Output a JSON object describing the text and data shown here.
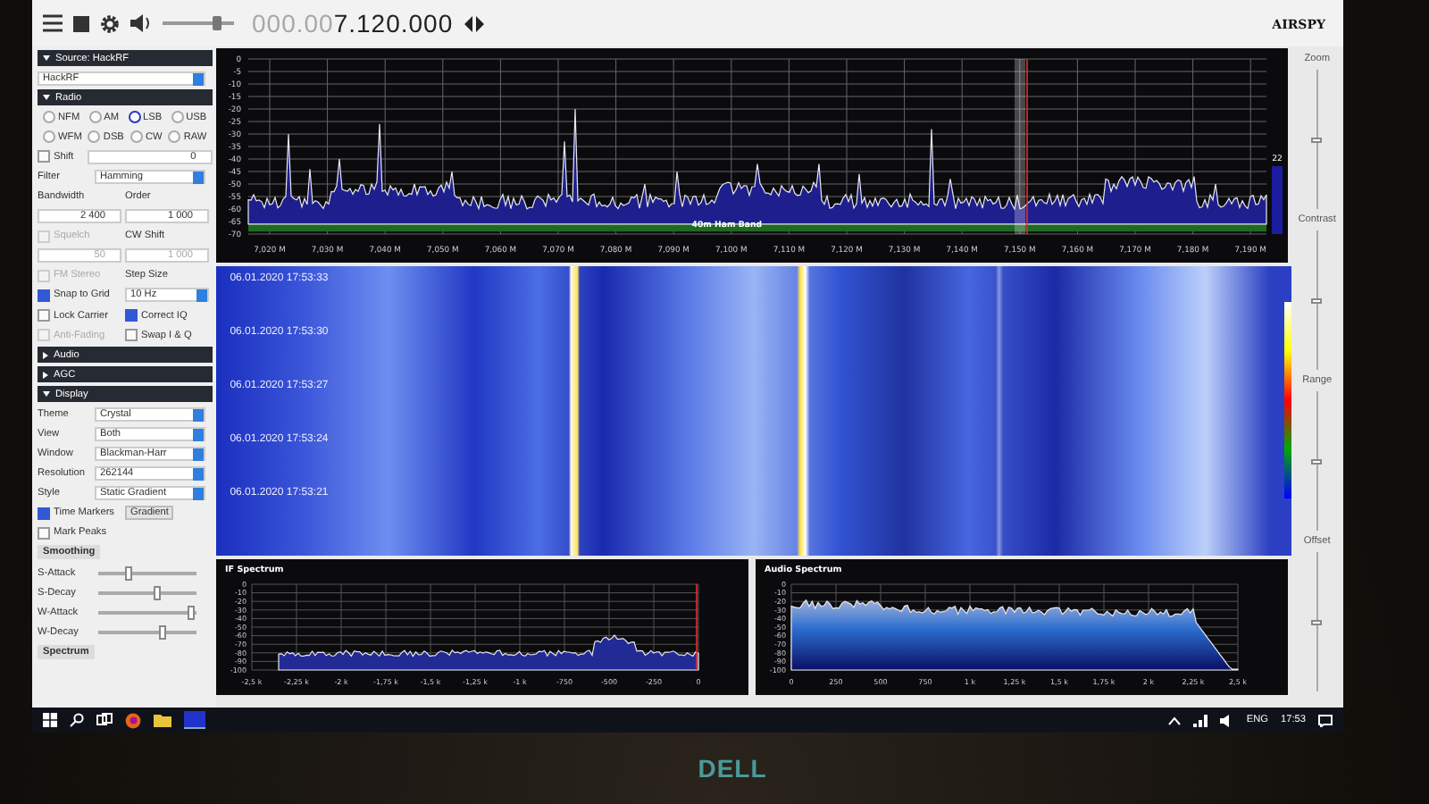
{
  "toolbar": {
    "volume": {
      "level": 0.75
    },
    "frequency_dim": "000.00",
    "frequency": "7.120.000",
    "logo": "AIRSPY"
  },
  "sidebar": {
    "rows": [
      {
        "kind": "header",
        "label": "Source: HackRF",
        "expanded": true
      },
      {
        "kind": "select",
        "value": "HackRF"
      },
      {
        "kind": "header",
        "label": "Radio",
        "expanded": true
      },
      {
        "kind": "radios",
        "options": [
          {
            "label": "NFM",
            "selected": false
          },
          {
            "label": "AM",
            "selected": false
          },
          {
            "label": "LSB",
            "selected": true
          },
          {
            "label": "USB",
            "selected": false
          }
        ]
      },
      {
        "kind": "radios",
        "options": [
          {
            "label": "WFM",
            "selected": false
          },
          {
            "label": "DSB",
            "selected": false
          },
          {
            "label": "CW",
            "selected": false
          },
          {
            "label": "RAW",
            "selected": false
          }
        ]
      },
      {
        "kind": "check_spin",
        "check": {
          "label": "Shift",
          "checked": false,
          "disabled": false
        },
        "value": "0"
      },
      {
        "kind": "field_select",
        "label": "Filter",
        "value": "Hamming"
      },
      {
        "kind": "captions",
        "items": [
          "Bandwidth",
          "Order"
        ]
      },
      {
        "kind": "spins",
        "items": [
          {
            "value": "2 400",
            "disabled": false
          },
          {
            "value": "1 000",
            "disabled": false
          }
        ]
      },
      {
        "kind": "check_caption",
        "check": {
          "label": "Squelch",
          "checked": false,
          "disabled": true
        },
        "caption": "CW Shift"
      },
      {
        "kind": "spins",
        "items": [
          {
            "value": "50",
            "disabled": true
          },
          {
            "value": "1 000",
            "disabled": true
          }
        ]
      },
      {
        "kind": "check_caption",
        "check": {
          "label": "FM Stereo",
          "checked": false,
          "disabled": true
        },
        "caption": "Step Size"
      },
      {
        "kind": "check_select",
        "check": {
          "label": "Snap to Grid",
          "checked": true,
          "disabled": false
        },
        "value": "10 Hz"
      },
      {
        "kind": "checks",
        "items": [
          {
            "label": "Lock Carrier",
            "checked": false,
            "disabled": false
          },
          {
            "label": "Correct IQ",
            "checked": true,
            "disabled": false
          }
        ]
      },
      {
        "kind": "checks",
        "items": [
          {
            "label": "Anti-Fading",
            "checked": false,
            "disabled": true
          },
          {
            "label": "Swap I & Q",
            "checked": false,
            "disabled": false
          }
        ]
      },
      {
        "kind": "header",
        "label": "Audio",
        "expanded": false
      },
      {
        "kind": "header",
        "label": "AGC",
        "expanded": false
      },
      {
        "kind": "header",
        "label": "Display",
        "expanded": true
      },
      {
        "kind": "field_select",
        "label": "Theme",
        "value": "Crystal"
      },
      {
        "kind": "field_select",
        "label": "View",
        "value": "Both"
      },
      {
        "kind": "field_select",
        "label": "Window",
        "value": "Blackman-Harr"
      },
      {
        "kind": "field_select",
        "label": "Resolution",
        "value": "262144"
      },
      {
        "kind": "field_select",
        "label": "Style",
        "value": "Static Gradient"
      },
      {
        "kind": "check_button",
        "check": {
          "label": "Time Markers",
          "checked": true,
          "disabled": false
        },
        "button": "Gradient"
      },
      {
        "kind": "checks",
        "items": [
          {
            "label": "Mark Peaks",
            "checked": false,
            "disabled": false
          }
        ]
      },
      {
        "kind": "group",
        "label": "Smoothing"
      },
      {
        "kind": "slider",
        "label": "S-Attack",
        "level": 0.3
      },
      {
        "kind": "slider",
        "label": "S-Decay",
        "level": 0.6
      },
      {
        "kind": "slider",
        "label": "W-Attack",
        "level": 0.95
      },
      {
        "kind": "slider",
        "label": "W-Decay",
        "level": 0.65
      },
      {
        "kind": "group",
        "label": "Spectrum"
      }
    ]
  },
  "spectrum": {
    "y_ticks": [
      "0",
      "-5",
      "-10",
      "-15",
      "-20",
      "-25",
      "-30",
      "-35",
      "-40",
      "-45",
      "-50",
      "-55",
      "-60",
      "-65",
      "-70"
    ],
    "x_ticks": [
      "7,020 M",
      "7,030 M",
      "7,040 M",
      "7,050 M",
      "7,060 M",
      "7,070 M",
      "7,080 M",
      "7,090 M",
      "7,100 M",
      "7,110 M",
      "7,120 M",
      "7,130 M",
      "7,140 M",
      "7,150 M",
      "7,160 M",
      "7,170 M",
      "7,180 M",
      "7,190 M"
    ],
    "band_label": "40m Ham Band",
    "scale_value": "22"
  },
  "waterfall": {
    "timestamps": [
      "06.01.2020 17:53:33",
      "06.01.2020 17:53:30",
      "06.01.2020 17:53:27",
      "06.01.2020 17:53:24",
      "06.01.2020 17:53:21"
    ]
  },
  "if_spectrum": {
    "title": "IF Spectrum",
    "y_ticks": [
      "0",
      "-10",
      "-20",
      "-30",
      "-40",
      "-50",
      "-60",
      "-70",
      "-80",
      "-90",
      "-100"
    ],
    "x_ticks": [
      "-2,5 k",
      "-2,25 k",
      "-2 k",
      "-1,75 k",
      "-1,5 k",
      "-1,25 k",
      "-1 k",
      "-750",
      "-500",
      "-250",
      "0"
    ]
  },
  "audio_spectrum": {
    "title": "Audio Spectrum",
    "y_ticks": [
      "0",
      "-10",
      "-20",
      "-30",
      "-40",
      "-50",
      "-60",
      "-70",
      "-80",
      "-90",
      "-100"
    ],
    "x_ticks": [
      "0",
      "250",
      "500",
      "750",
      "1 k",
      "1,25 k",
      "1,5 k",
      "1,75 k",
      "2 k",
      "2,25 k",
      "2,5 k"
    ]
  },
  "right_sliders": [
    {
      "label": "Zoom",
      "level": 0.5
    },
    {
      "label": "Contrast",
      "level": 0.5
    },
    {
      "label": "Range",
      "level": 0.5
    },
    {
      "label": "Offset",
      "level": 0.5
    }
  ],
  "taskbar": {
    "language": "ENG",
    "time": "17:53"
  },
  "bezel_logo": "DELL"
}
